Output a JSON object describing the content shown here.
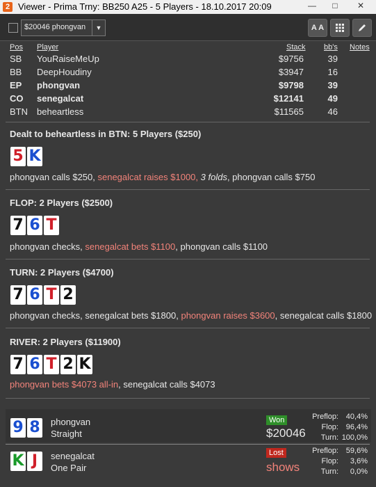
{
  "window": {
    "title": "Viewer - Prima Trny: BB250 A25 - 5 Players - 18.10.2017 20:09",
    "app_icon": "2"
  },
  "toolbar": {
    "selected_player": "$20046 phongvan",
    "font_button": "A A",
    "grid_icon": "grid-icon",
    "edit_icon": "pencil-icon"
  },
  "table": {
    "headers": {
      "pos": "Pos",
      "player": "Player",
      "stack": "Stack",
      "bbs": "bb's",
      "notes": "Notes"
    },
    "rows": [
      {
        "pos": "SB",
        "player": "YouRaiseMeUp",
        "stack": "$9756",
        "bbs": "39",
        "bold": false
      },
      {
        "pos": "BB",
        "player": "DeepHoudiny",
        "stack": "$3947",
        "bbs": "16",
        "bold": false
      },
      {
        "pos": "EP",
        "player": "phongvan",
        "stack": "$9798",
        "bbs": "39",
        "bold": true
      },
      {
        "pos": "CO",
        "player": "senegalcat",
        "stack": "$12141",
        "bbs": "49",
        "bold": true
      },
      {
        "pos": "BTN",
        "player": "beheartless",
        "stack": "$11565",
        "bbs": "46",
        "bold": false
      }
    ]
  },
  "preflop": {
    "heading": "Dealt to beheartless in BTN: 5 Players ($250)",
    "cards": [
      {
        "rank": "5",
        "suit": "red"
      },
      {
        "rank": "K",
        "suit": "blue"
      }
    ],
    "actions": {
      "a1": "phongvan calls $250, ",
      "a2": "senegalcat raises $1000, ",
      "a3": "3 folds",
      "a4": ", phongvan calls $750"
    }
  },
  "flop": {
    "heading": "FLOP: 2 Players ($2500)",
    "cards": [
      {
        "rank": "7",
        "suit": "black"
      },
      {
        "rank": "6",
        "suit": "blue"
      },
      {
        "rank": "T",
        "suit": "red"
      }
    ],
    "actions": {
      "a1": "phongvan checks, ",
      "a2": "senegalcat bets $1100",
      "a3": ", phongvan calls $1100"
    }
  },
  "turn": {
    "heading": "TURN: 2 Players ($4700)",
    "cards": [
      {
        "rank": "7",
        "suit": "black"
      },
      {
        "rank": "6",
        "suit": "blue"
      },
      {
        "rank": "T",
        "suit": "red"
      },
      {
        "rank": "2",
        "suit": "black"
      }
    ],
    "actions": {
      "a1": "phongvan checks, senegalcat bets $1800, ",
      "a2": "phongvan raises $3600",
      "a3": ", senegalcat calls $1800"
    }
  },
  "river": {
    "heading": "RIVER: 2 Players ($11900)",
    "cards": [
      {
        "rank": "7",
        "suit": "black"
      },
      {
        "rank": "6",
        "suit": "blue"
      },
      {
        "rank": "T",
        "suit": "red"
      },
      {
        "rank": "2",
        "suit": "black"
      },
      {
        "rank": "K",
        "suit": "black"
      }
    ],
    "actions": {
      "a1": "phongvan bets $4073 all-in",
      "a2": ", senegalcat calls $4073"
    }
  },
  "results": [
    {
      "name": "phongvan",
      "hand": "Straight",
      "cards": [
        {
          "rank": "9",
          "suit": "blue"
        },
        {
          "rank": "8",
          "suit": "blue"
        }
      ],
      "badge": "Won",
      "amount": "$20046",
      "equity": [
        {
          "label": "Preflop:",
          "value": "40,4%"
        },
        {
          "label": "Flop:",
          "value": "96,4%"
        },
        {
          "label": "Turn:",
          "value": "100,0%"
        }
      ]
    },
    {
      "name": "senegalcat",
      "hand": "One Pair",
      "cards": [
        {
          "rank": "K",
          "suit": "green"
        },
        {
          "rank": "J",
          "suit": "red"
        }
      ],
      "badge": "Lost",
      "amount": "shows",
      "equity": [
        {
          "label": "Preflop:",
          "value": "59,6%"
        },
        {
          "label": "Flop:",
          "value": "3,6%"
        },
        {
          "label": "Turn:",
          "value": "0,0%"
        }
      ]
    }
  ],
  "colors": {
    "background": "#3a3a3a",
    "highlight": "#f2837a",
    "won": "#2f8f2a",
    "lost": "#c0281e"
  }
}
